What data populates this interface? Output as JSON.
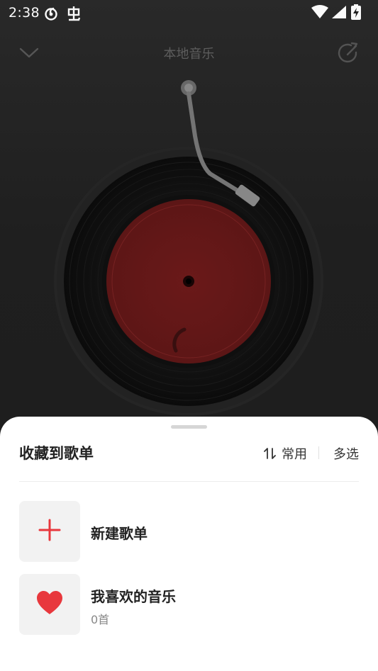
{
  "status_bar": {
    "time": "2:38"
  },
  "player": {
    "title": "本地音乐"
  },
  "sheet": {
    "title": "收藏到歌单",
    "sort_label": "常用",
    "multi_select_label": "多选",
    "playlists": [
      {
        "name": "新建歌单",
        "icon": "plus-icon"
      },
      {
        "name": "我喜欢的音乐",
        "count": "0首",
        "icon": "heart-icon"
      }
    ]
  },
  "colors": {
    "accent": "#e8383d",
    "record_label": "#8b1e1e",
    "sheet_background": "#ffffff"
  }
}
